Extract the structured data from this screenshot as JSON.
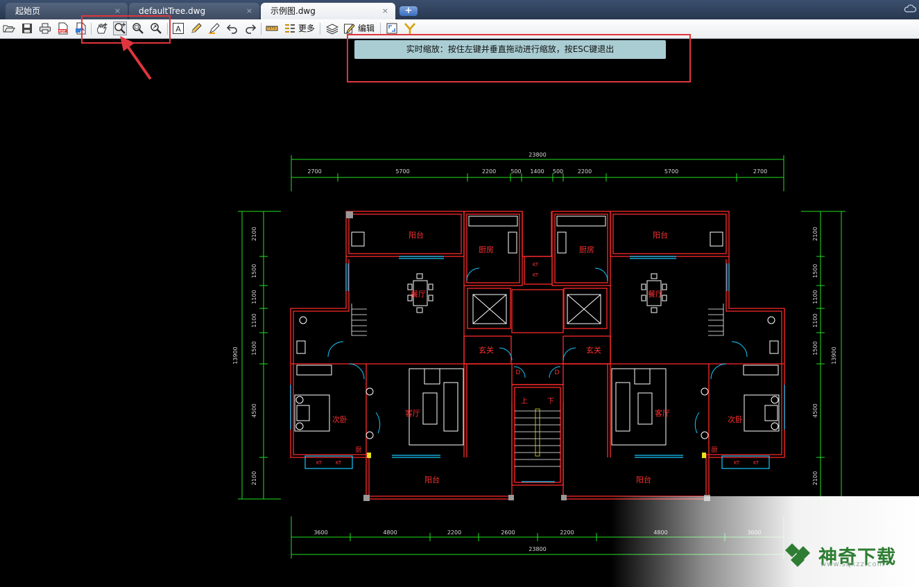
{
  "tabs": [
    {
      "label": "起始页",
      "close": "×"
    },
    {
      "label": "defaultTree.dwg",
      "close": "×"
    },
    {
      "label": "示例图.dwg",
      "close": "×"
    }
  ],
  "add_tab": "+",
  "toolbar": {
    "more_label": "更多",
    "edit_label": "编辑",
    "text_icon_letter": "A"
  },
  "hint": "实时缩放：按住左键并垂直拖动进行缩放，按ESC键退出",
  "drawing": {
    "top_dims_total": "23800",
    "top_dims": [
      "2700",
      "5700",
      "2200",
      "500",
      "1400",
      "500",
      "2200",
      "5700",
      "2700"
    ],
    "bottom_dims": [
      "3600",
      "4800",
      "2200",
      "2600",
      "2200",
      "4800",
      "3600"
    ],
    "bottom_dims_total": "23800",
    "left_dims": [
      "2100",
      "1500",
      "1100",
      "1100",
      "1500",
      "4500",
      "2100"
    ],
    "left_total": "13900",
    "right_dims": [
      "2100",
      "1500",
      "1100",
      "1100",
      "1500",
      "4500",
      "2100"
    ],
    "right_total": "13900",
    "rooms": {
      "balcony": "阳台",
      "kitchen": "厨房",
      "dining": "餐厅",
      "foyer": "玄关",
      "living": "客厅",
      "second_bedroom": "次卧",
      "bath_a": "厨",
      "bath_b": "卫",
      "stair_up": "上",
      "stair_down": "下",
      "d_label": "D",
      "kt": "KT"
    }
  },
  "watermark": {
    "title": "神奇下载",
    "url": "www.sqxzz.com"
  },
  "colors": {
    "wall": "#ff2a2a",
    "dim": "#22e022",
    "window": "#18c8ff",
    "label": "#ff3030",
    "annot": "#e0353c"
  }
}
